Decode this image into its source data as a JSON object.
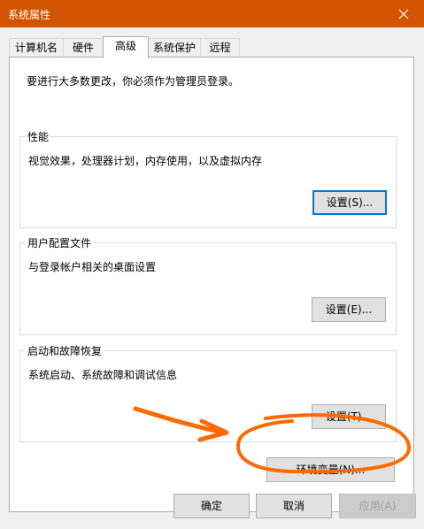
{
  "window": {
    "title": "系统属性"
  },
  "tabs": [
    {
      "label": "计算机名"
    },
    {
      "label": "硬件"
    },
    {
      "label": "高级"
    },
    {
      "label": "系统保护"
    },
    {
      "label": "远程"
    }
  ],
  "active_tab": "高级",
  "panel": {
    "intro": "要进行大多数更改，你必须作为管理员登录。",
    "performance": {
      "title": "性能",
      "description": "视觉效果，处理器计划，内存使用，以及虚拟内存",
      "button": "设置(S)..."
    },
    "user_profiles": {
      "title": "用户配置文件",
      "description": "与登录帐户相关的桌面设置",
      "button": "设置(E)..."
    },
    "startup_recovery": {
      "title": "启动和故障恢复",
      "description": "系统启动、系统故障和调试信息",
      "button": "设置(T)..."
    },
    "env_button": "环境变量(N)..."
  },
  "footer": {
    "ok": "确定",
    "cancel": "取消",
    "apply": "应用(A)"
  },
  "colors": {
    "titlebar": "#d35400",
    "annotation": "#ff6a00",
    "focus": "#0078d7"
  },
  "icons": {
    "close": "close-icon",
    "annotation": "hand-drawn-arrow-and-circle"
  }
}
